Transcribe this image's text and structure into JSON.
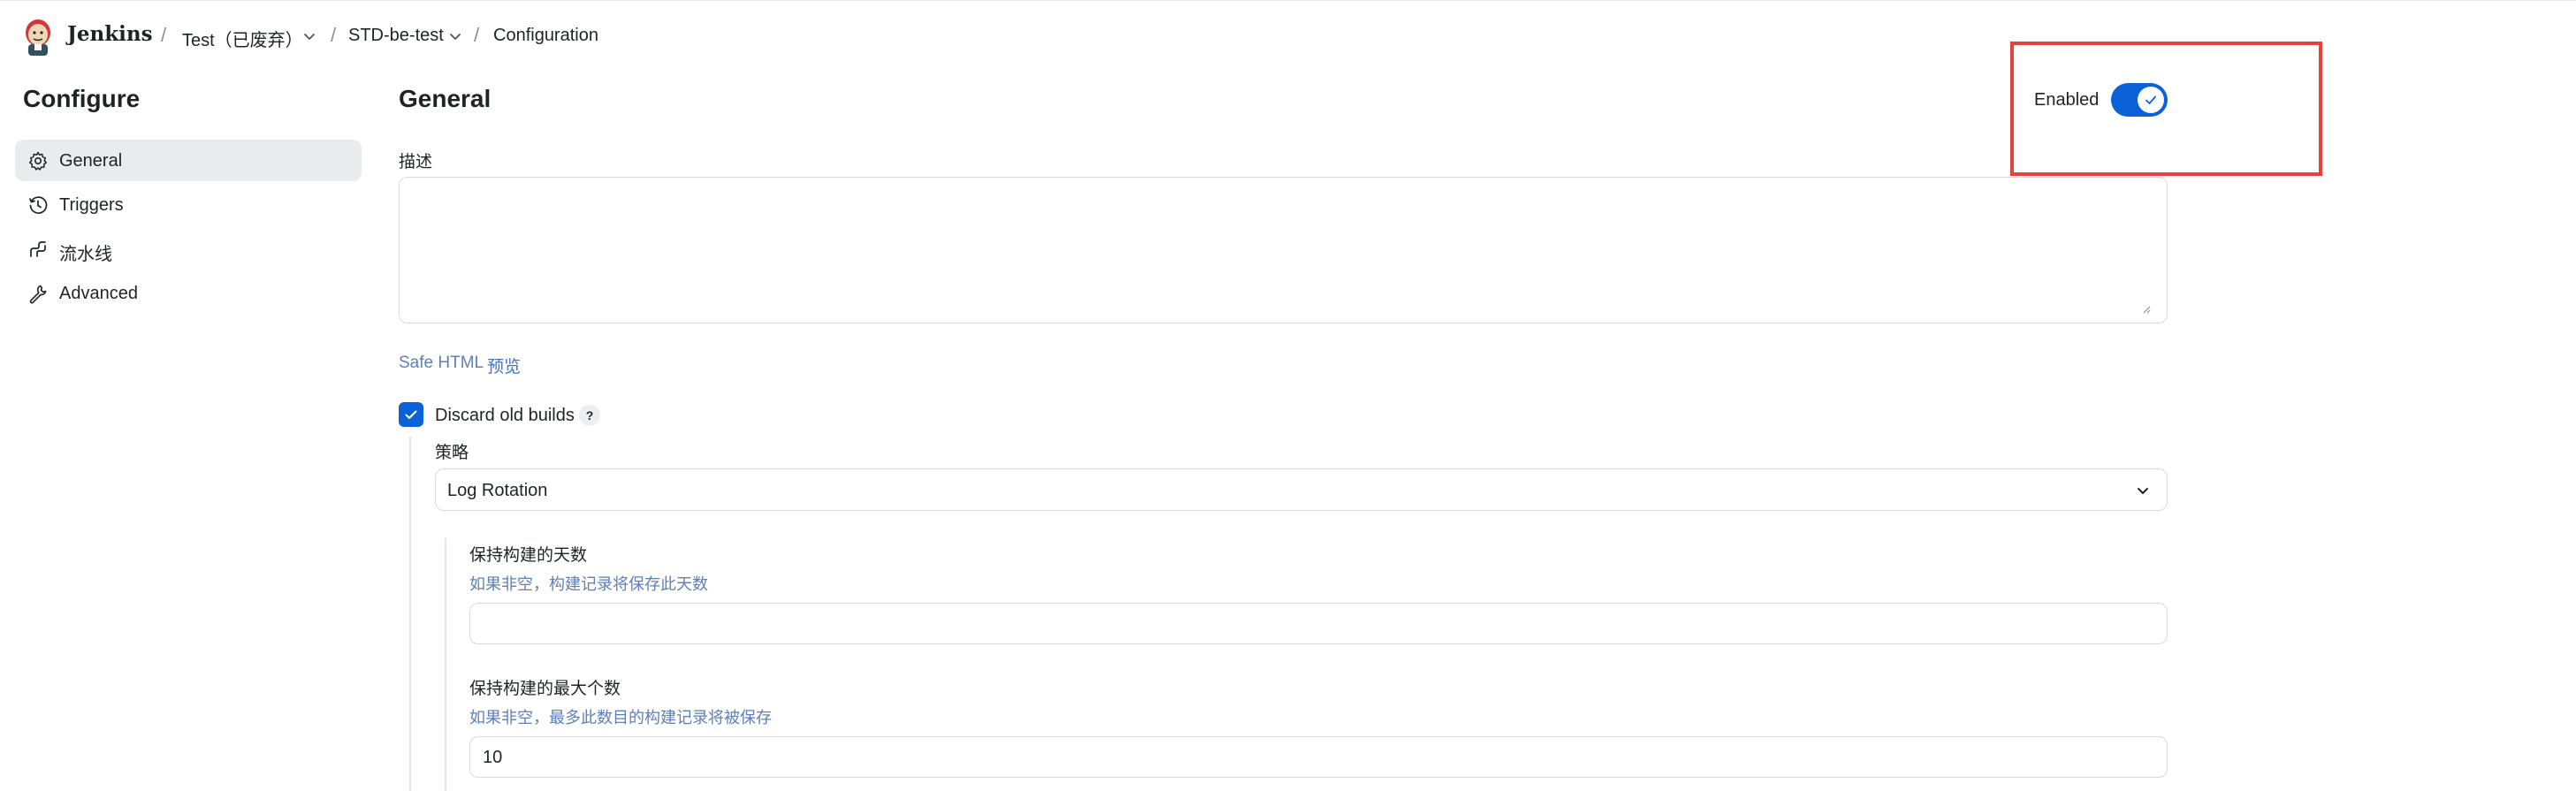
{
  "header": {
    "brand": "Jenkins",
    "breadcrumbs": [
      {
        "label": "Test（已废弃）",
        "has_dropdown": true
      },
      {
        "label": "STD-be-test",
        "has_dropdown": true
      },
      {
        "label": "Configuration",
        "has_dropdown": false
      }
    ],
    "separator": "/"
  },
  "sidebar": {
    "title": "Configure",
    "items": [
      {
        "label": "General",
        "icon": "gear-icon",
        "active": true
      },
      {
        "label": "Triggers",
        "icon": "clock-icon",
        "active": false
      },
      {
        "label": "流水线",
        "icon": "pipeline-icon",
        "active": false
      },
      {
        "label": "Advanced",
        "icon": "wrench-icon",
        "active": false
      }
    ]
  },
  "main": {
    "section_title": "General",
    "enabled": {
      "label": "Enabled",
      "value": true
    },
    "description": {
      "label": "描述",
      "value": ""
    },
    "safe_html": {
      "label": "Safe HTML",
      "preview_link": "预览"
    },
    "discard_old_builds": {
      "label": "Discard old builds",
      "checked": true,
      "help": "?"
    },
    "strategy": {
      "label": "策略",
      "selected": "Log Rotation"
    },
    "days_to_keep": {
      "label": "保持构建的天数",
      "hint": "如果非空，构建记录将保存此天数",
      "value": ""
    },
    "max_builds": {
      "label": "保持构建的最大个数",
      "hint": "如果非空，最多此数目的构建记录将被保存",
      "value": "10"
    }
  },
  "colors": {
    "accent": "#0b61d8",
    "link": "#3f73c8",
    "highlight": "#e8413a"
  }
}
